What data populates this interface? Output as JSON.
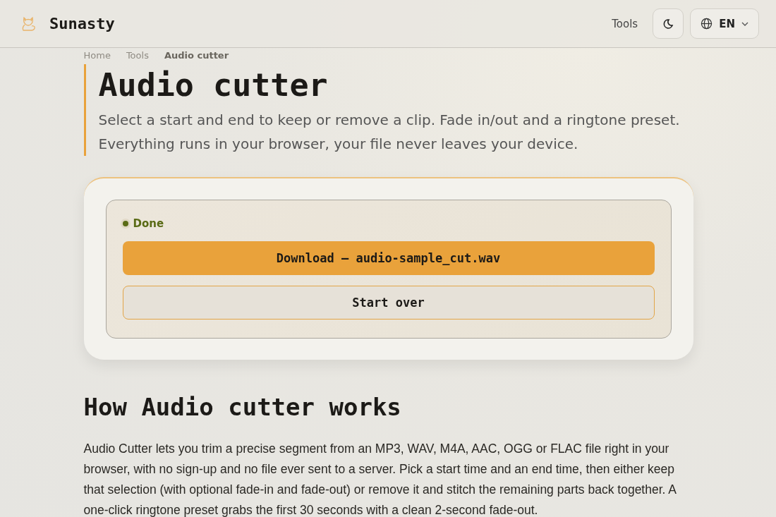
{
  "header": {
    "brand": "Sunasty",
    "nav_link": "Tools",
    "language": "EN"
  },
  "breadcrumb": [
    {
      "label": "Home",
      "current": false
    },
    {
      "label": "Tools",
      "current": false
    },
    {
      "label": "Audio cutter",
      "current": true
    }
  ],
  "title": "Audio cutter",
  "lead": [
    "Select a start and end to keep or remove a clip. Fade in/out and a ringtone preset.",
    "Everything runs in your browser, your file never leaves your device."
  ],
  "result": {
    "status": "Done",
    "download_button": "Download — audio-sample_cut.wav",
    "start_over_button": "Start over"
  },
  "how_it_works": {
    "heading": "How Audio cutter works",
    "paragraph": "Audio Cutter lets you trim a precise segment from an MP3, WAV, M4A, AAC, OGG or FLAC file right in your browser, with no sign-up and no file ever sent to a server. Pick a start time and an end time, then either keep that selection (with optional fade-in and fade-out) or remove it and stitch the remaining parts back together. A one-click ringtone preset grabs the first 30 seconds with a clean 2-second fade-out."
  }
}
